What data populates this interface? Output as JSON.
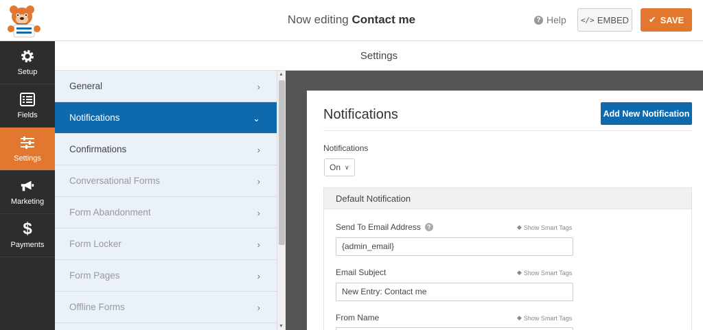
{
  "header": {
    "title_prefix": "Now editing",
    "form_name": "Contact me",
    "help_label": "Help",
    "embed_label": "EMBED",
    "save_label": "SAVE"
  },
  "leftnav": {
    "items": [
      {
        "label": "Setup",
        "icon": "gear-icon"
      },
      {
        "label": "Fields",
        "icon": "list-icon"
      },
      {
        "label": "Settings",
        "icon": "sliders-icon"
      },
      {
        "label": "Marketing",
        "icon": "megaphone-icon"
      },
      {
        "label": "Payments",
        "icon": "dollar-icon"
      }
    ],
    "active": "Settings"
  },
  "settings": {
    "title": "Settings",
    "menu": [
      {
        "label": "General"
      },
      {
        "label": "Notifications"
      },
      {
        "label": "Confirmations"
      },
      {
        "label": "Conversational Forms"
      },
      {
        "label": "Form Abandonment"
      },
      {
        "label": "Form Locker"
      },
      {
        "label": "Form Pages"
      },
      {
        "label": "Offline Forms"
      }
    ]
  },
  "panel": {
    "title": "Notifications",
    "add_button": "Add New Notification",
    "notifications_label": "Notifications",
    "notifications_value": "On",
    "default_notification": {
      "title": "Default Notification",
      "smart_tags_label": "Show Smart Tags",
      "fields": [
        {
          "label": "Send To Email Address",
          "value": "{admin_email}"
        },
        {
          "label": "Email Subject",
          "value": "New Entry: Contact me"
        },
        {
          "label": "From Name",
          "value": ""
        }
      ]
    }
  },
  "colors": {
    "accent_orange": "#e27730",
    "primary_blue": "#0e6aad",
    "nav_dark": "#2d2d2d"
  }
}
